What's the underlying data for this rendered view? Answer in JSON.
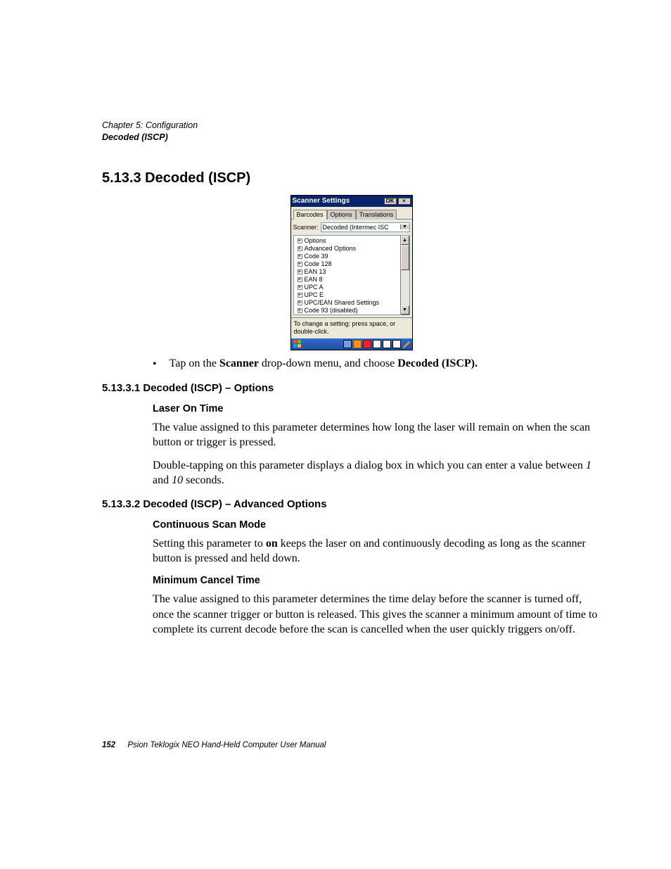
{
  "running_head": {
    "chapter": "Chapter 5: Configuration",
    "section": "Decoded (ISCP)"
  },
  "heading_1": "5.13.3   Decoded (ISCP)",
  "screenshot": {
    "title": "Scanner Settings",
    "ok": "OK",
    "close": "×",
    "tabs": [
      "Barcodes",
      "Options",
      "Translations"
    ],
    "scanner_label": "Scanner:",
    "scanner_value": "Decoded (Intermec ISC",
    "tree": [
      "Options",
      "Advanced Options",
      "Code 39",
      "Code 128",
      "EAN 13",
      "EAN 8",
      "UPC A",
      "UPC E",
      "UPC/EAN Shared Settings",
      "Code 93 (disabled)"
    ],
    "hint": "To change a setting: press space, or double-click."
  },
  "bullet": {
    "pre": "Tap on the ",
    "bold1": "Scanner",
    "mid": " drop-down menu, and choose ",
    "bold2": "Decoded (ISCP)."
  },
  "sub1": {
    "heading": "5.13.3.1 Decoded (ISCP) – Options",
    "h4": "Laser On Time",
    "p1": "The value assigned to this parameter determines how long the laser will remain on when the scan button or trigger is pressed.",
    "p2a": "Double-tapping on this parameter displays a dialog box in which you can enter a value between ",
    "p2b": "1",
    "p2c": " and ",
    "p2d": "10",
    "p2e": " seconds."
  },
  "sub2": {
    "heading": "5.13.3.2 Decoded (ISCP) – Advanced Options",
    "h4a": "Continuous Scan Mode",
    "p1a": "Setting this parameter to ",
    "p1b": "on",
    "p1c": " keeps the laser on and continuously decoding as long as the scanner button is pressed and held down.",
    "h4b": "Minimum Cancel Time",
    "p2": "The value assigned to this parameter determines the time delay before the scanner is turned off, once the scanner trigger or button is released. This gives the scanner a minimum amount of time to complete its current decode before the scan is cancelled when the user quickly triggers on/off."
  },
  "footer": {
    "page": "152",
    "text": "Psion Teklogix NEO Hand-Held Computer User Manual"
  }
}
